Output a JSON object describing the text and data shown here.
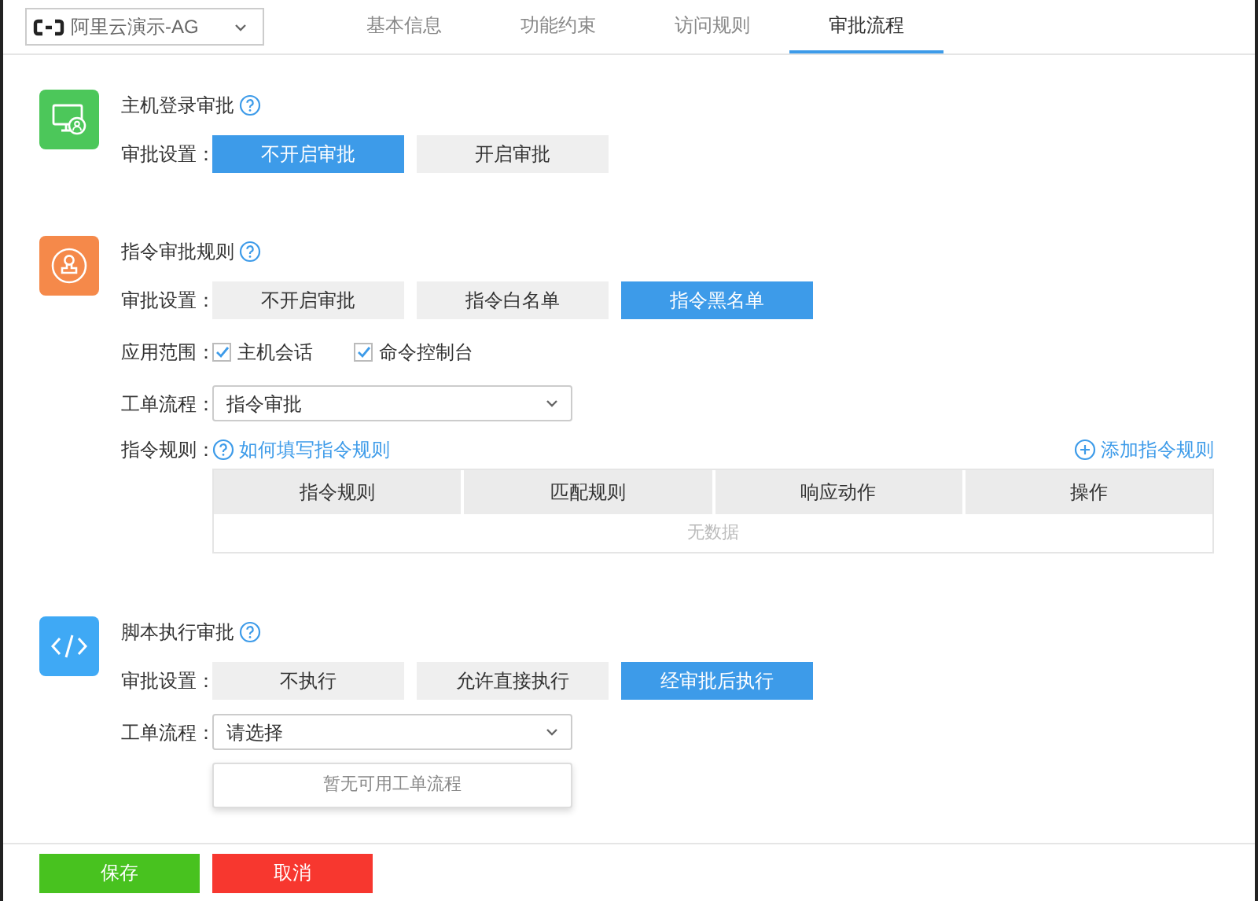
{
  "account_select": {
    "value": "阿里云演示-AG"
  },
  "tabs": [
    {
      "label": "基本信息",
      "selected": false
    },
    {
      "label": "功能约束",
      "selected": false
    },
    {
      "label": "访问规则",
      "selected": false
    },
    {
      "label": "审批流程",
      "selected": true
    }
  ],
  "sections": [
    {
      "kind": "host",
      "title": "主机登录审批",
      "rows": [
        {
          "kind": "options",
          "label": "审批设置：",
          "options": [
            {
              "label": "不开启审批",
              "selected": true
            },
            {
              "label": "开启审批",
              "selected": false
            }
          ]
        }
      ]
    },
    {
      "kind": "command",
      "title": "指令审批规则",
      "rows": [
        {
          "kind": "options",
          "label": "审批设置：",
          "options": [
            {
              "label": "不开启审批",
              "selected": false
            },
            {
              "label": "指令白名单",
              "selected": false
            },
            {
              "label": "指令黑名单",
              "selected": true
            }
          ]
        },
        {
          "kind": "checkboxes",
          "label": "应用范围：",
          "items": [
            {
              "label": "主机会话",
              "checked": true
            },
            {
              "label": "命令控制台",
              "checked": true
            }
          ]
        },
        {
          "kind": "select",
          "label": "工单流程：",
          "value": "指令审批"
        },
        {
          "kind": "rules",
          "label": "指令规则：",
          "help_link": "如何填写指令规则",
          "add_link": "添加指令规则",
          "columns": [
            "指令规则",
            "匹配规则",
            "响应动作",
            "操作"
          ],
          "empty": "无数据"
        }
      ]
    },
    {
      "kind": "script",
      "title": "脚本执行审批",
      "rows": [
        {
          "kind": "options",
          "label": "审批设置：",
          "options": [
            {
              "label": "不执行",
              "selected": false
            },
            {
              "label": "允许直接执行",
              "selected": false
            },
            {
              "label": "经审批后执行",
              "selected": true
            }
          ]
        },
        {
          "kind": "select",
          "label": "工单流程：",
          "placeholder": "请选择",
          "expanded": true,
          "dropdown_empty": "暂无可用工单流程"
        }
      ]
    }
  ],
  "footer_buttons": [
    {
      "label": "保存",
      "kind": "primary"
    },
    {
      "label": "取消",
      "kind": "danger"
    }
  ]
}
